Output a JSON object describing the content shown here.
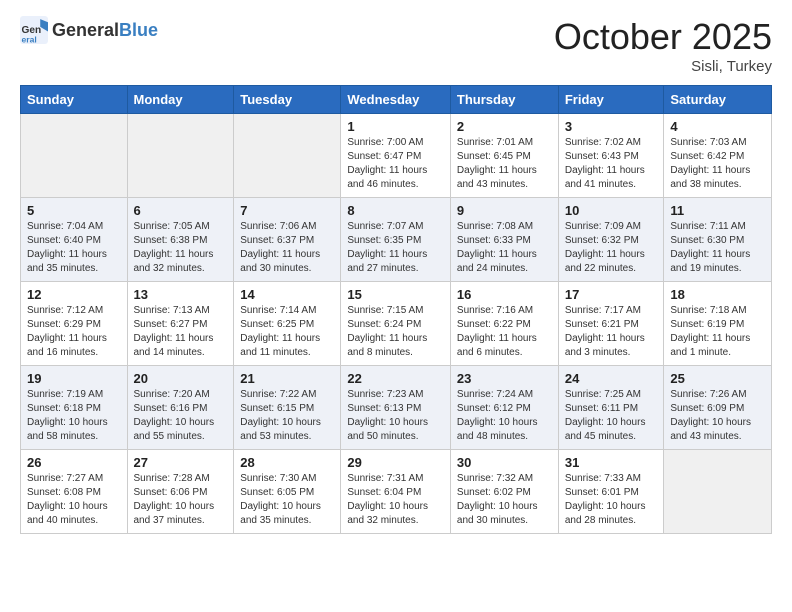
{
  "header": {
    "logo_general": "General",
    "logo_blue": "Blue",
    "month_title": "October 2025",
    "location": "Sisli, Turkey"
  },
  "days_of_week": [
    "Sunday",
    "Monday",
    "Tuesday",
    "Wednesday",
    "Thursday",
    "Friday",
    "Saturday"
  ],
  "weeks": [
    {
      "days": [
        {
          "num": "",
          "info": ""
        },
        {
          "num": "",
          "info": ""
        },
        {
          "num": "",
          "info": ""
        },
        {
          "num": "1",
          "info": "Sunrise: 7:00 AM\nSunset: 6:47 PM\nDaylight: 11 hours\nand 46 minutes."
        },
        {
          "num": "2",
          "info": "Sunrise: 7:01 AM\nSunset: 6:45 PM\nDaylight: 11 hours\nand 43 minutes."
        },
        {
          "num": "3",
          "info": "Sunrise: 7:02 AM\nSunset: 6:43 PM\nDaylight: 11 hours\nand 41 minutes."
        },
        {
          "num": "4",
          "info": "Sunrise: 7:03 AM\nSunset: 6:42 PM\nDaylight: 11 hours\nand 38 minutes."
        }
      ]
    },
    {
      "days": [
        {
          "num": "5",
          "info": "Sunrise: 7:04 AM\nSunset: 6:40 PM\nDaylight: 11 hours\nand 35 minutes."
        },
        {
          "num": "6",
          "info": "Sunrise: 7:05 AM\nSunset: 6:38 PM\nDaylight: 11 hours\nand 32 minutes."
        },
        {
          "num": "7",
          "info": "Sunrise: 7:06 AM\nSunset: 6:37 PM\nDaylight: 11 hours\nand 30 minutes."
        },
        {
          "num": "8",
          "info": "Sunrise: 7:07 AM\nSunset: 6:35 PM\nDaylight: 11 hours\nand 27 minutes."
        },
        {
          "num": "9",
          "info": "Sunrise: 7:08 AM\nSunset: 6:33 PM\nDaylight: 11 hours\nand 24 minutes."
        },
        {
          "num": "10",
          "info": "Sunrise: 7:09 AM\nSunset: 6:32 PM\nDaylight: 11 hours\nand 22 minutes."
        },
        {
          "num": "11",
          "info": "Sunrise: 7:11 AM\nSunset: 6:30 PM\nDaylight: 11 hours\nand 19 minutes."
        }
      ]
    },
    {
      "days": [
        {
          "num": "12",
          "info": "Sunrise: 7:12 AM\nSunset: 6:29 PM\nDaylight: 11 hours\nand 16 minutes."
        },
        {
          "num": "13",
          "info": "Sunrise: 7:13 AM\nSunset: 6:27 PM\nDaylight: 11 hours\nand 14 minutes."
        },
        {
          "num": "14",
          "info": "Sunrise: 7:14 AM\nSunset: 6:25 PM\nDaylight: 11 hours\nand 11 minutes."
        },
        {
          "num": "15",
          "info": "Sunrise: 7:15 AM\nSunset: 6:24 PM\nDaylight: 11 hours\nand 8 minutes."
        },
        {
          "num": "16",
          "info": "Sunrise: 7:16 AM\nSunset: 6:22 PM\nDaylight: 11 hours\nand 6 minutes."
        },
        {
          "num": "17",
          "info": "Sunrise: 7:17 AM\nSunset: 6:21 PM\nDaylight: 11 hours\nand 3 minutes."
        },
        {
          "num": "18",
          "info": "Sunrise: 7:18 AM\nSunset: 6:19 PM\nDaylight: 11 hours\nand 1 minute."
        }
      ]
    },
    {
      "days": [
        {
          "num": "19",
          "info": "Sunrise: 7:19 AM\nSunset: 6:18 PM\nDaylight: 10 hours\nand 58 minutes."
        },
        {
          "num": "20",
          "info": "Sunrise: 7:20 AM\nSunset: 6:16 PM\nDaylight: 10 hours\nand 55 minutes."
        },
        {
          "num": "21",
          "info": "Sunrise: 7:22 AM\nSunset: 6:15 PM\nDaylight: 10 hours\nand 53 minutes."
        },
        {
          "num": "22",
          "info": "Sunrise: 7:23 AM\nSunset: 6:13 PM\nDaylight: 10 hours\nand 50 minutes."
        },
        {
          "num": "23",
          "info": "Sunrise: 7:24 AM\nSunset: 6:12 PM\nDaylight: 10 hours\nand 48 minutes."
        },
        {
          "num": "24",
          "info": "Sunrise: 7:25 AM\nSunset: 6:11 PM\nDaylight: 10 hours\nand 45 minutes."
        },
        {
          "num": "25",
          "info": "Sunrise: 7:26 AM\nSunset: 6:09 PM\nDaylight: 10 hours\nand 43 minutes."
        }
      ]
    },
    {
      "days": [
        {
          "num": "26",
          "info": "Sunrise: 7:27 AM\nSunset: 6:08 PM\nDaylight: 10 hours\nand 40 minutes."
        },
        {
          "num": "27",
          "info": "Sunrise: 7:28 AM\nSunset: 6:06 PM\nDaylight: 10 hours\nand 37 minutes."
        },
        {
          "num": "28",
          "info": "Sunrise: 7:30 AM\nSunset: 6:05 PM\nDaylight: 10 hours\nand 35 minutes."
        },
        {
          "num": "29",
          "info": "Sunrise: 7:31 AM\nSunset: 6:04 PM\nDaylight: 10 hours\nand 32 minutes."
        },
        {
          "num": "30",
          "info": "Sunrise: 7:32 AM\nSunset: 6:02 PM\nDaylight: 10 hours\nand 30 minutes."
        },
        {
          "num": "31",
          "info": "Sunrise: 7:33 AM\nSunset: 6:01 PM\nDaylight: 10 hours\nand 28 minutes."
        },
        {
          "num": "",
          "info": ""
        }
      ]
    }
  ]
}
